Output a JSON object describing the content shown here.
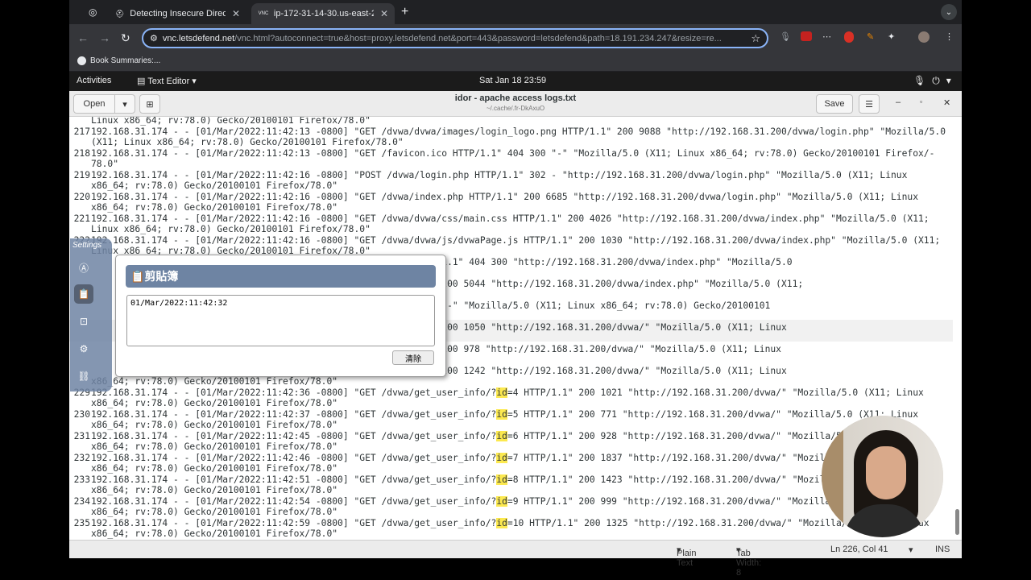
{
  "browser": {
    "tabs": [
      {
        "label": "Detecting Insecure Direct Ob",
        "favicon": "helmet-icon"
      },
      {
        "label": "ip-172-31-14-30.us-east-2.c",
        "favicon": "vnc-icon",
        "favicon_text": "VNC"
      }
    ],
    "url_host": "vnc.letsdefend.net",
    "url_rest": "/vnc.html?autoconnect=true&host=proxy.letsdefend.net&port=443&password=letsdefend&path=18.191.234.247&resize=re...",
    "bookmark": "Book Summaries:..."
  },
  "gnome": {
    "activities": "Activities",
    "app_menu": "Text Editor",
    "clock": "Sat Jan 18  23:59"
  },
  "editor": {
    "open_label": "Open",
    "save_label": "Save",
    "title": "idor - apache access logs.txt",
    "subtitle": "~/.cache/.fr-DkAxuO",
    "status": {
      "language": "Plain Text",
      "tab_width": "Tab Width: 8",
      "position": "Ln 226, Col 41",
      "mode": "INS"
    }
  },
  "lines": [
    {
      "n": "",
      "t": "Linux x86_64; rv:78.0) Gecko/20100101 Firefox/78.0\""
    },
    {
      "n": "217",
      "t": "192.168.31.174 - - [01/Mar/2022:11:42:13 -0800] \"GET /dvwa/dvwa/images/login_logo.png HTTP/1.1\" 200 9088 \"http://192.168.31.200/dvwa/login.php\" \"Mozilla/5.0"
    },
    {
      "n": "",
      "t": "(X11; Linux x86_64; rv:78.0) Gecko/20100101 Firefox/78.0\""
    },
    {
      "n": "218",
      "t": "192.168.31.174 - - [01/Mar/2022:11:42:13 -0800] \"GET /favicon.ico HTTP/1.1\" 404 300 \"-\" \"Mozilla/5.0 (X11; Linux x86_64; rv:78.0) Gecko/20100101 Firefox/-"
    },
    {
      "n": "",
      "t": "78.0\""
    },
    {
      "n": "219",
      "t": "192.168.31.174 - - [01/Mar/2022:11:42:16 -0800] \"POST /dvwa/login.php HTTP/1.1\" 302 - \"http://192.168.31.200/dvwa/login.php\" \"Mozilla/5.0 (X11; Linux"
    },
    {
      "n": "",
      "t": "x86_64; rv:78.0) Gecko/20100101 Firefox/78.0\""
    },
    {
      "n": "220",
      "t": "192.168.31.174 - - [01/Mar/2022:11:42:16 -0800] \"GET /dvwa/index.php HTTP/1.1\" 200 6685 \"http://192.168.31.200/dvwa/login.php\" \"Mozilla/5.0 (X11; Linux"
    },
    {
      "n": "",
      "t": "x86_64; rv:78.0) Gecko/20100101 Firefox/78.0\""
    },
    {
      "n": "221",
      "t": "192.168.31.174 - - [01/Mar/2022:11:42:16 -0800] \"GET /dvwa/dvwa/css/main.css HTTP/1.1\" 200 4026 \"http://192.168.31.200/dvwa/index.php\" \"Mozilla/5.0 (X11;"
    },
    {
      "n": "",
      "t": "Linux x86_64; rv:78.0) Gecko/20100101 Firefox/78.0\""
    },
    {
      "n": "222",
      "t": "192.168.31.174 - - [01/Mar/2022:11:42:16 -0800] \"GET /dvwa/dvwa/js/dvwaPage.js HTTP/1.1\" 200 1030 \"http://192.168.31.200/dvwa/index.php\" \"Mozilla/5.0 (X11;"
    },
    {
      "n": "",
      "t": "Linux x86_64; rv:78.0) Gecko/20100101 Firefox/78.0\""
    },
    {
      "n": "",
      "t": "                                       _event_listeners.js HTTP/1.1\" 404 300 \"http://192.168.31.200/dvwa/index.php\" \"Mozilla/5.0"
    },
    {
      "n": "",
      "t": ""
    },
    {
      "n": "",
      "t": "                                       mages/logo.png HTTP/1.1\" 200 5044 \"http://192.168.31.200/dvwa/index.php\" \"Mozilla/5.0 (X11;"
    },
    {
      "n": "",
      "t": ""
    },
    {
      "n": "",
      "t": "                                       n.ico HTTP/1.1\" 200 1406 \"-\" \"Mozilla/5.0 (X11; Linux x86_64; rv:78.0) Gecko/20100101"
    },
    {
      "n": "",
      "t": ""
    },
    {
      "n": "",
      "t": "                                       ser_info/?",
      "hl": "id",
      "t2": "=1 HTTP/1.1\" 200 1050 \"http://192.168.31.200/dvwa/\" \"Mozilla/5.0 (X11; Linux"
    },
    {
      "n": "",
      "t": ""
    },
    {
      "n": "",
      "t": "                                       ser_info/?",
      "hl": "id",
      "t2": "=2 HTTP/1.1\" 200 978 \"http://192.168.31.200/dvwa/\" \"Mozilla/5.0 (X11; Linux"
    },
    {
      "n": "",
      "t": ""
    },
    {
      "n": "",
      "t": "                                       ser_info/?",
      "hl": "id",
      "t2": "=3 HTTP/1.1\" 200 1242 \"http://192.168.31.200/dvwa/\" \"Mozilla/5.0 (X11; Linux"
    },
    {
      "n": "",
      "t": "x86_64; rv:78.0) Gecko/20100101 Firefox/78.0\""
    },
    {
      "n": "229",
      "t": "192.168.31.174 - - [01/Mar/2022:11:42:36 -0800] \"GET /dvwa/get_user_info/?",
      "hl": "id",
      "t2": "=4 HTTP/1.1\" 200 1021 \"http://192.168.31.200/dvwa/\" \"Mozilla/5.0 (X11; Linux"
    },
    {
      "n": "",
      "t": "x86_64; rv:78.0) Gecko/20100101 Firefox/78.0\""
    },
    {
      "n": "230",
      "t": "192.168.31.174 - - [01/Mar/2022:11:42:37 -0800] \"GET /dvwa/get_user_info/?",
      "hl": "id",
      "t2": "=5 HTTP/1.1\" 200 771 \"http://192.168.31.200/dvwa/\" \"Mozilla/5.0 (X11; Linux"
    },
    {
      "n": "",
      "t": "x86_64; rv:78.0) Gecko/20100101 Firefox/78.0\""
    },
    {
      "n": "231",
      "t": "192.168.31.174 - - [01/Mar/2022:11:42:45 -0800] \"GET /dvwa/get_user_info/?",
      "hl": "id",
      "t2": "=6 HTTP/1.1\" 200 928 \"http://192.168.31.200/dvwa/\" \"Mozilla/5.0 (X11; Linux"
    },
    {
      "n": "",
      "t": "x86_64; rv:78.0) Gecko/20100101 Firefox/78.0\""
    },
    {
      "n": "232",
      "t": "192.168.31.174 - - [01/Mar/2022:11:42:46 -0800] \"GET /dvwa/get_user_info/?",
      "hl": "id",
      "t2": "=7 HTTP/1.1\" 200 1837 \"http://192.168.31.200/dvwa/\" \"Mozilla/5.0 (X11; Linux"
    },
    {
      "n": "",
      "t": "x86_64; rv:78.0) Gecko/20100101 Firefox/78.0\""
    },
    {
      "n": "233",
      "t": "192.168.31.174 - - [01/Mar/2022:11:42:51 -0800] \"GET /dvwa/get_user_info/?",
      "hl": "id",
      "t2": "=8 HTTP/1.1\" 200 1423 \"http://192.168.31.200/dvwa/\" \"Mozilla/5.0 (X11; Linux"
    },
    {
      "n": "",
      "t": "x86_64; rv:78.0) Gecko/20100101 Firefox/78.0\""
    },
    {
      "n": "234",
      "t": "192.168.31.174 - - [01/Mar/2022:11:42:54 -0800] \"GET /dvwa/get_user_info/?",
      "hl": "id",
      "t2": "=9 HTTP/1.1\" 200 999 \"http://192.168.31.200/dvwa/\" \"Mozilla/5.0 (X11; Linux"
    },
    {
      "n": "",
      "t": "x86_64; rv:78.0) Gecko/20100101 Firefox/78.0\""
    },
    {
      "n": "235",
      "t": "192.168.31.174 - - [01/Mar/2022:11:42:59 -0800] \"GET /dvwa/get_user_info/?",
      "hl": "id",
      "t2": "=10 HTTP/1.1\" 200 1325 \"http://192.168.31.200/dvwa/\" \"Mozilla/5.0 (X11; Linux"
    },
    {
      "n": "",
      "t": "x86_64; rv:78.0) Gecko/20100101 Firefox/78.0\""
    }
  ],
  "vnc": {
    "settings_label": "Settings",
    "clipboard_title": "剪貼簿",
    "clipboard_text": "01/Mar/2022:11:42:32",
    "clear_label": "清除"
  }
}
